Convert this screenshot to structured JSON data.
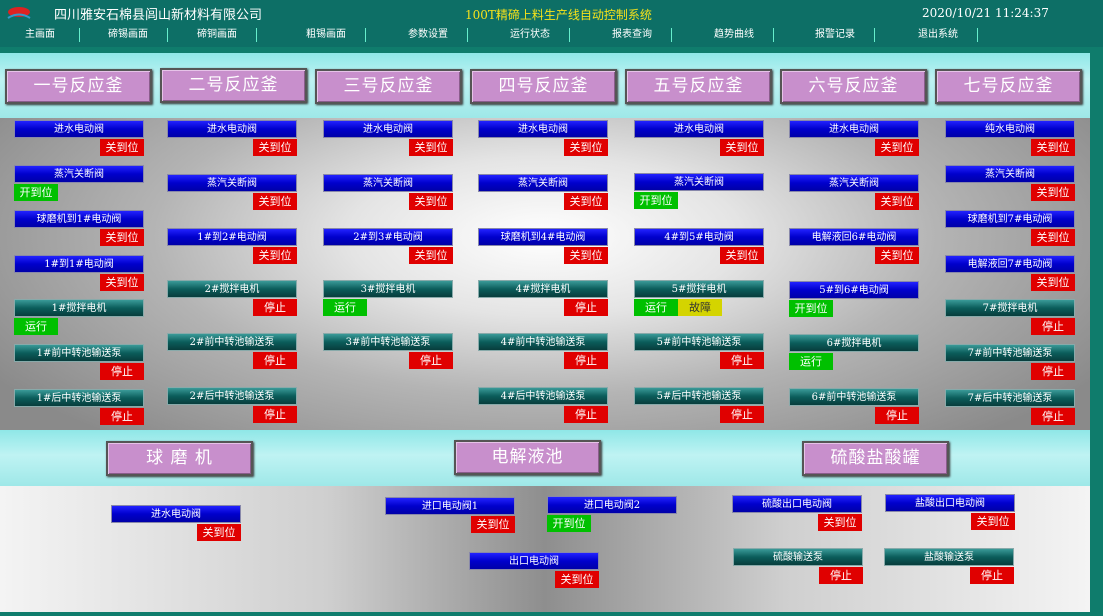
{
  "header": {
    "company": "四川雅安石棉县闾山新材料有限公司",
    "title": "100T精碲上料生产线自动控制系统",
    "clock": "2020/10/21 11:24:37",
    "logo_icon": "company-logo-icon"
  },
  "menu": [
    "主画面",
    "碲锡画面",
    "碲铜画面",
    "粗锡画面",
    "参数设置",
    "运行状态",
    "报表查询",
    "趋势曲线",
    "报警记录",
    "退出系统"
  ],
  "reactors": [
    "一号反应釜",
    "二号反应釜",
    "三号反应釜",
    "四号反应釜",
    "五号反应釜",
    "六号反应釜",
    "七号反应釜"
  ],
  "devices": {
    "r1": [
      {
        "label": "进水电动阀",
        "status": "关到位"
      },
      {
        "label": "蒸汽关断阀",
        "status": "开到位"
      },
      {
        "label": "球磨机到1#电动阀",
        "status": "关到位"
      },
      {
        "label": "1#到1#电动阀",
        "status": "关到位"
      },
      {
        "label": "1#搅拌电机",
        "status": "运行"
      },
      {
        "label": "1#前中转池输送泵",
        "status": "停止"
      },
      {
        "label": "1#后中转池输送泵",
        "status": "停止"
      }
    ],
    "r2": [
      {
        "label": "进水电动阀",
        "status": "关到位"
      },
      {
        "label": "蒸汽关断阀",
        "status": "关到位"
      },
      {
        "label": "1#到2#电动阀",
        "status": "关到位"
      },
      {
        "label": "2#搅拌电机",
        "status": "停止"
      },
      {
        "label": "2#前中转池输送泵",
        "status": "停止"
      },
      {
        "label": "2#后中转池输送泵",
        "status": "停止"
      }
    ],
    "r3": [
      {
        "label": "进水电动阀",
        "status": "关到位"
      },
      {
        "label": "蒸汽关断阀",
        "status": "关到位"
      },
      {
        "label": "2#到3#电动阀",
        "status": "关到位"
      },
      {
        "label": "3#搅拌电机",
        "status": "运行"
      },
      {
        "label": "3#前中转池输送泵",
        "status": "停止"
      }
    ],
    "r4": [
      {
        "label": "进水电动阀",
        "status": "关到位"
      },
      {
        "label": "蒸汽关断阀",
        "status": "关到位"
      },
      {
        "label": "球磨机到4#电动阀",
        "status": "关到位"
      },
      {
        "label": "4#搅拌电机",
        "status": "停止"
      },
      {
        "label": "4#前中转池输送泵",
        "status": "停止"
      },
      {
        "label": "4#后中转池输送泵",
        "status": "停止"
      }
    ],
    "r5": [
      {
        "label": "进水电动阀",
        "status": "关到位"
      },
      {
        "label": "蒸汽关断阀",
        "status": "开到位"
      },
      {
        "label": "4#到5#电动阀",
        "status": "关到位"
      },
      {
        "label": "5#搅拌电机",
        "status": "运行",
        "status2": "故障"
      },
      {
        "label": "5#前中转池输送泵",
        "status": "停止"
      },
      {
        "label": "5#后中转池输送泵",
        "status": "停止"
      }
    ],
    "r6": [
      {
        "label": "进水电动阀",
        "status": "关到位"
      },
      {
        "label": "蒸汽关断阀",
        "status": "关到位"
      },
      {
        "label": "电解液回6#电动阀",
        "status": "关到位"
      },
      {
        "label": "5#到6#电动阀",
        "status": "开到位"
      },
      {
        "label": "6#搅拌电机",
        "status": "运行"
      },
      {
        "label": "6#前中转池输送泵",
        "status": "停止"
      }
    ],
    "r7": [
      {
        "label": "纯水电动阀",
        "status": "关到位"
      },
      {
        "label": "蒸汽关断阀",
        "status": "关到位"
      },
      {
        "label": "球磨机到7#电动阀",
        "status": "关到位"
      },
      {
        "label": "电解液回7#电动阀",
        "status": "关到位"
      },
      {
        "label": "7#搅拌电机",
        "status": "停止"
      },
      {
        "label": "7#前中转池输送泵",
        "status": "停止"
      },
      {
        "label": "7#后中转池输送泵",
        "status": "停止"
      }
    ]
  },
  "sections": [
    "球 磨 机",
    "电解液池",
    "硫酸盐酸罐"
  ],
  "bottom": {
    "ball": {
      "label": "进水电动阀",
      "status": "关到位"
    },
    "elec": [
      {
        "label": "进口电动阀1",
        "status": "关到位"
      },
      {
        "label": "进口电动阀2",
        "status": "开到位"
      },
      {
        "label": "出口电动阀",
        "status": "关到位"
      }
    ],
    "acid": [
      {
        "label": "硫酸出口电动阀",
        "status": "关到位"
      },
      {
        "label": "盐酸出口电动阀",
        "status": "关到位"
      },
      {
        "label": "硫酸输送泵",
        "status": "停止"
      },
      {
        "label": "盐酸输送泵",
        "status": "停止"
      }
    ]
  },
  "colors": {
    "closed": "#e00000",
    "open": "#00c000",
    "fault": "#d4d400"
  }
}
